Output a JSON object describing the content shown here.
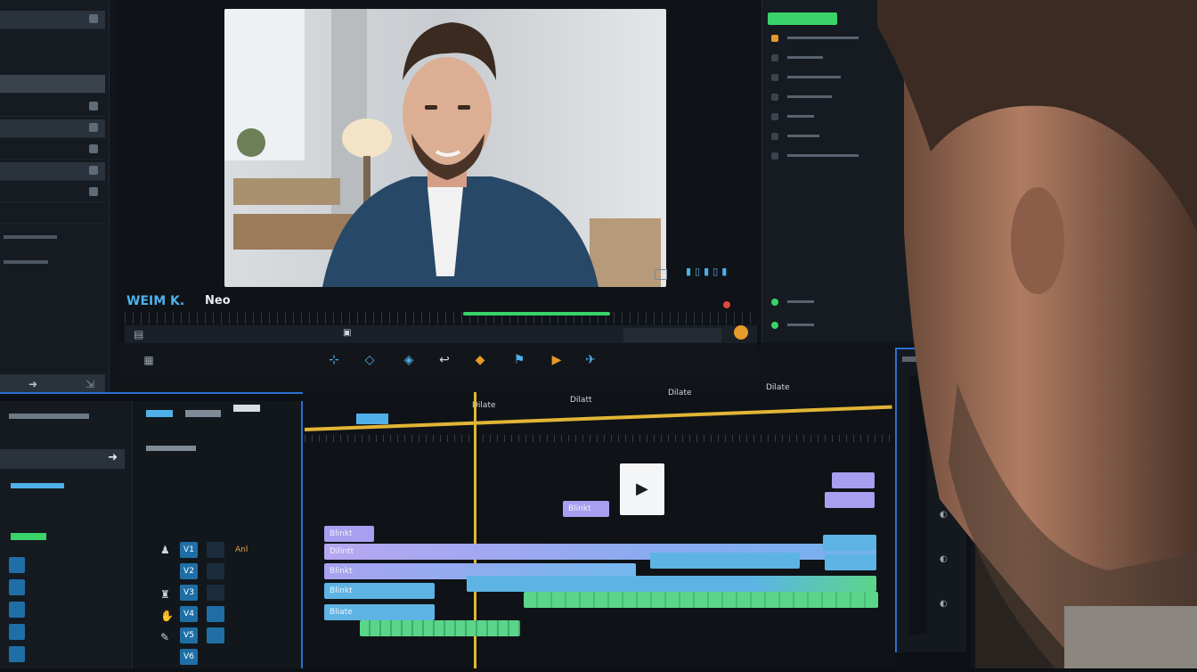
{
  "preview": {
    "project_title": "WEIM K.",
    "project_tag": "Neo"
  },
  "left_panel": {
    "rows": [
      "",
      "",
      "",
      "",
      "",
      "",
      "",
      "",
      "",
      ""
    ]
  },
  "timeline": {
    "tracks_v": [
      "V1",
      "V2",
      "V3",
      "V4",
      "V5",
      "V6"
    ],
    "clip_labels": [
      "Blinkt",
      "Dilintt",
      "Blinkt",
      "Blinkt",
      "Bliate",
      "Blinkt"
    ],
    "header_labels": [
      "Dilate",
      "Dilatt",
      "Dilate",
      "Dilate"
    ]
  },
  "accent_colors": {
    "timeline_border": "#2c6fd1",
    "playhead": "#e2b536",
    "purple_clip": "#a99ef0",
    "blue_clip": "#5db4e4",
    "green_clip": "#5bd58a",
    "progress": "#39d36a"
  }
}
